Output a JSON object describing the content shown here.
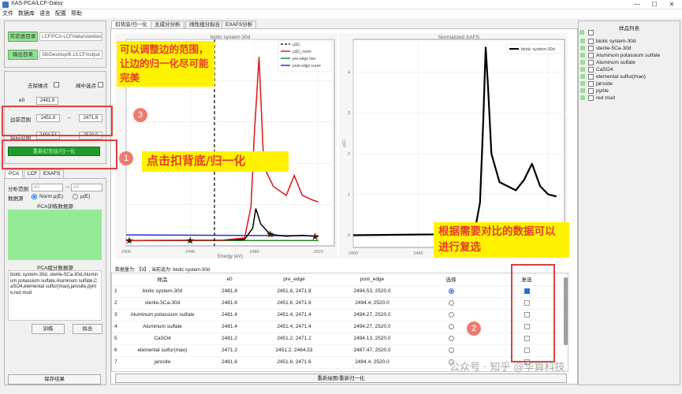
{
  "window": {
    "title": "XAS-PCA/LCF-Daisy",
    "minimize": "—",
    "maximize": "☐",
    "close": "✕"
  },
  "menu": [
    "文件",
    "数据库",
    "语言",
    "配置",
    "帮助"
  ],
  "left": {
    "exp_dir_button": "实验进目录",
    "exp_dir_path": "LCF/PCA-LCF/data/standard",
    "out_dir_button": "输出目录",
    "out_dir_path": "SB/Desktop/B.1/LCF/output",
    "remove_noise": "去除噪点",
    "select_all": "阀中选点",
    "e0_label": "e0",
    "e0_value": "2481.8",
    "edge_label": "边前范围",
    "edge_from": "2451.8",
    "edge_sep": "–",
    "edge_to": "2471.8",
    "post_label": "边后范围",
    "post_from": "2494.53",
    "post_sep": "–",
    "post_to": "2520.0",
    "normalize_button": "重新扣背底/归一化",
    "tabs": [
      "PCA",
      "LCF",
      "EXAFS"
    ],
    "range_label": "分析范围",
    "range_from_placeholder": "eV",
    "range_to_placeholder": "eV",
    "data_source_label": "数据源",
    "norm_option": "Norm μ(E)",
    "mu_option": "μ(E)",
    "train_label": "PCA训练数据源",
    "comp_label": "PCA组分数据源",
    "comp_text": "biotic system-30d, sterile-5Ca-30d,Aluminum potassium sulfate,Aluminum sulfate,CaSO4,elemental sulfur(mao),jarosite,pyrite,red mud",
    "train_button": "训练",
    "fit_button": "拟合",
    "save_button": "保存结果"
  },
  "main_tabs": [
    "扣背底/归一化",
    "主成分分析",
    "线性组分拟合",
    "EXAFS分析"
  ],
  "plot_left": {
    "title": "biotic system-30d",
    "xlabel": "Energy (eV)",
    "legend": [
      "μ(E)",
      "μ(E)_norm",
      "pre-edge line",
      "post-edge curve"
    ],
    "xticks": [
      "2400",
      "2440",
      "2480",
      "2520"
    ]
  },
  "plot_right": {
    "title": "Normalized XAFS",
    "legend": [
      "biotic system-30d"
    ],
    "ylabel": "μ(E)",
    "yticks": [
      "0",
      "1",
      "2",
      "3",
      "4"
    ],
    "xticks": [
      "2400",
      "2440",
      "2480",
      "2520"
    ]
  },
  "chart_data": [
    {
      "type": "line",
      "title": "biotic system-30d",
      "xlabel": "Energy (eV)",
      "xlim": [
        2400,
        2530
      ],
      "series": [
        {
          "name": "μ(E)",
          "color": "#000000",
          "x": [
            2400,
            2460,
            2474,
            2479,
            2481,
            2484,
            2490,
            2500,
            2510,
            2520
          ],
          "y": [
            0.02,
            0.03,
            0.05,
            0.3,
            0.75,
            0.4,
            0.16,
            0.12,
            0.14,
            0.11
          ]
        },
        {
          "name": "μ(E)_norm",
          "color": "#dd2222",
          "x": [
            2400,
            2460,
            2474,
            2478,
            2480,
            2483,
            2486,
            2492,
            2500,
            2505,
            2510,
            2516,
            2520
          ],
          "y": [
            0.02,
            0.03,
            0.08,
            0.8,
            2.4,
            4.2,
            1.7,
            1.25,
            1.05,
            1.5,
            1.05,
            0.95,
            0.9
          ]
        },
        {
          "name": "pre-edge line",
          "color": "#228822",
          "x": [
            2400,
            2520
          ],
          "y": [
            0.02,
            0.02
          ]
        },
        {
          "name": "post-edge curve",
          "color": "#2233cc",
          "x": [
            2400,
            2520
          ],
          "y": [
            0.15,
            0.13
          ]
        }
      ]
    },
    {
      "type": "line",
      "title": "Normalized XAFS",
      "ylabel": "μ(E)",
      "xlim": [
        2400,
        2530
      ],
      "ylim": [
        0,
        4.8
      ],
      "series": [
        {
          "name": "biotic system-30d",
          "color": "#000000",
          "x": [
            2400,
            2450,
            2470,
            2475,
            2478,
            2480,
            2481.5,
            2483,
            2485,
            2490,
            2500,
            2505,
            2510,
            2515,
            2520,
            2525
          ],
          "y": [
            0.0,
            0.02,
            0.05,
            0.15,
            0.8,
            2.8,
            4.6,
            3.6,
            2.0,
            1.3,
            1.1,
            1.35,
            1.75,
            1.2,
            1.0,
            0.95
          ]
        }
      ]
    }
  ],
  "table": {
    "info": "数据量为: 【9】, 当前选为: biotic system-30d",
    "headers": [
      "",
      "样品",
      "e0",
      "pre_edge",
      "post_edge",
      "选择",
      "复选"
    ],
    "rows": [
      {
        "idx": "1",
        "name": "biotic system-30d",
        "e0": "2481.8",
        "pre": "2451.8, 2471.8",
        "post": "2494.53, 2520.0",
        "sel": true,
        "multi": true
      },
      {
        "idx": "2",
        "name": "sterile-5Ca-30d",
        "e0": "2481.6",
        "pre": "2451.6, 2471.6",
        "post": "2494.4, 2520.0",
        "sel": false,
        "multi": false
      },
      {
        "idx": "3",
        "name": "Aluminum potassium sulfate",
        "e0": "2481.4",
        "pre": "2451.4, 2471.4",
        "post": "2494.27, 2520.0",
        "sel": false,
        "multi": false
      },
      {
        "idx": "4",
        "name": "Aluminum sulfate",
        "e0": "2481.4",
        "pre": "2451.4, 2471.4",
        "post": "2494.27, 2520.0",
        "sel": false,
        "multi": false
      },
      {
        "idx": "5",
        "name": "CaSO4",
        "e0": "2481.2",
        "pre": "2451.2, 2471.2",
        "post": "2494.13, 2520.0",
        "sel": false,
        "multi": false
      },
      {
        "idx": "6",
        "name": "elemental sulfur(mao)",
        "e0": "2471.2",
        "pre": "2451.2, 2464.53",
        "post": "2487.47, 2520.0",
        "sel": false,
        "multi": false
      },
      {
        "idx": "7",
        "name": "jarosite",
        "e0": "2481.6",
        "pre": "2451.6, 2471.6",
        "post": "2494.4, 2520.0",
        "sel": false,
        "multi": false
      }
    ],
    "redraw_button": "重新绘图/重新归一化"
  },
  "samples": {
    "title": "样品列表",
    "items": [
      "biotic system-30d",
      "sterile-5Ca-30d",
      "Aluminum potassium sulfate",
      "Aluminum sulfate",
      "CaSO4",
      "elemental sulfur(mao)",
      "jarosite",
      "pyrite",
      "red mud"
    ]
  },
  "annotations": {
    "callout_range": "可以调整边的范围，让边的归一化尽可能完美",
    "callout_normalize": "点击扣背底/归一化",
    "callout_compare": "根据需要对比的数据可以进行复选",
    "badge1": "1",
    "badge2": "2",
    "badge3": "3"
  },
  "watermark": "公众号 · 知乎 @华算科技"
}
